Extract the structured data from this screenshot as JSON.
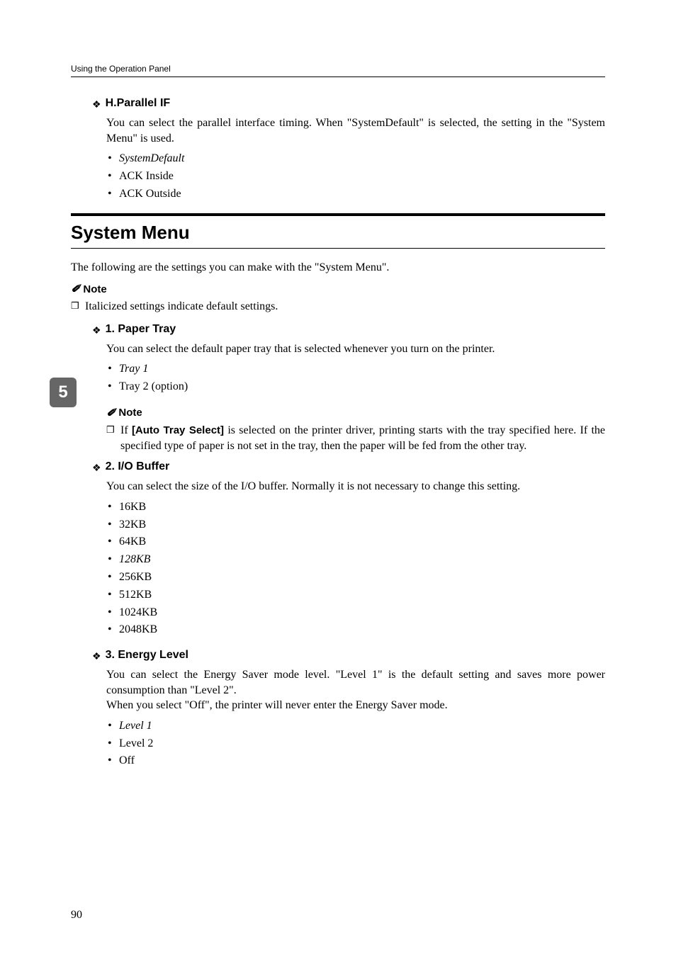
{
  "header": {
    "running": "Using the Operation Panel"
  },
  "sec_hparallel": {
    "title": "H.Parallel IF",
    "desc": "You can select the parallel interface timing. When \"SystemDefault\" is selected, the setting in the \"System Menu\" is used.",
    "items": [
      "SystemDefault",
      "ACK Inside",
      "ACK Outside"
    ],
    "default_index": 0
  },
  "system_menu": {
    "heading": "System Menu",
    "intro": "The following are the settings you can make with the \"System Menu\".",
    "note_label": "Note",
    "note_text": "Italicized settings indicate default settings."
  },
  "paper_tray": {
    "title": "1. Paper Tray",
    "desc": "You can select the default paper tray that is selected whenever you turn on the printer.",
    "items": [
      "Tray 1",
      "Tray 2 (option)"
    ],
    "default_index": 0,
    "note_label": "Note",
    "note_prefix": "If ",
    "note_bold": "[Auto Tray Select]",
    "note_rest": " is selected on the printer driver, printing starts with the tray specified here. If the specified type of paper is not set in the tray, then the paper will be fed from the other tray."
  },
  "io_buffer": {
    "title": "2. I/O Buffer",
    "desc": "You can select the size of the I/O buffer. Normally it is not necessary to change this setting.",
    "items": [
      "16KB",
      "32KB",
      "64KB",
      "128KB",
      "256KB",
      "512KB",
      "1024KB",
      "2048KB"
    ],
    "default_index": 3
  },
  "energy_level": {
    "title": "3. Energy Level",
    "desc1": "You can select the Energy Saver mode level. \"Level 1\" is the default setting and saves more power consumption than \"Level 2\".",
    "desc2": "When you select \"Off\", the printer will never enter the Energy Saver mode.",
    "items": [
      "Level 1",
      "Level 2",
      "Off"
    ],
    "default_index": 0
  },
  "side_tab": "5",
  "page_number": "90"
}
